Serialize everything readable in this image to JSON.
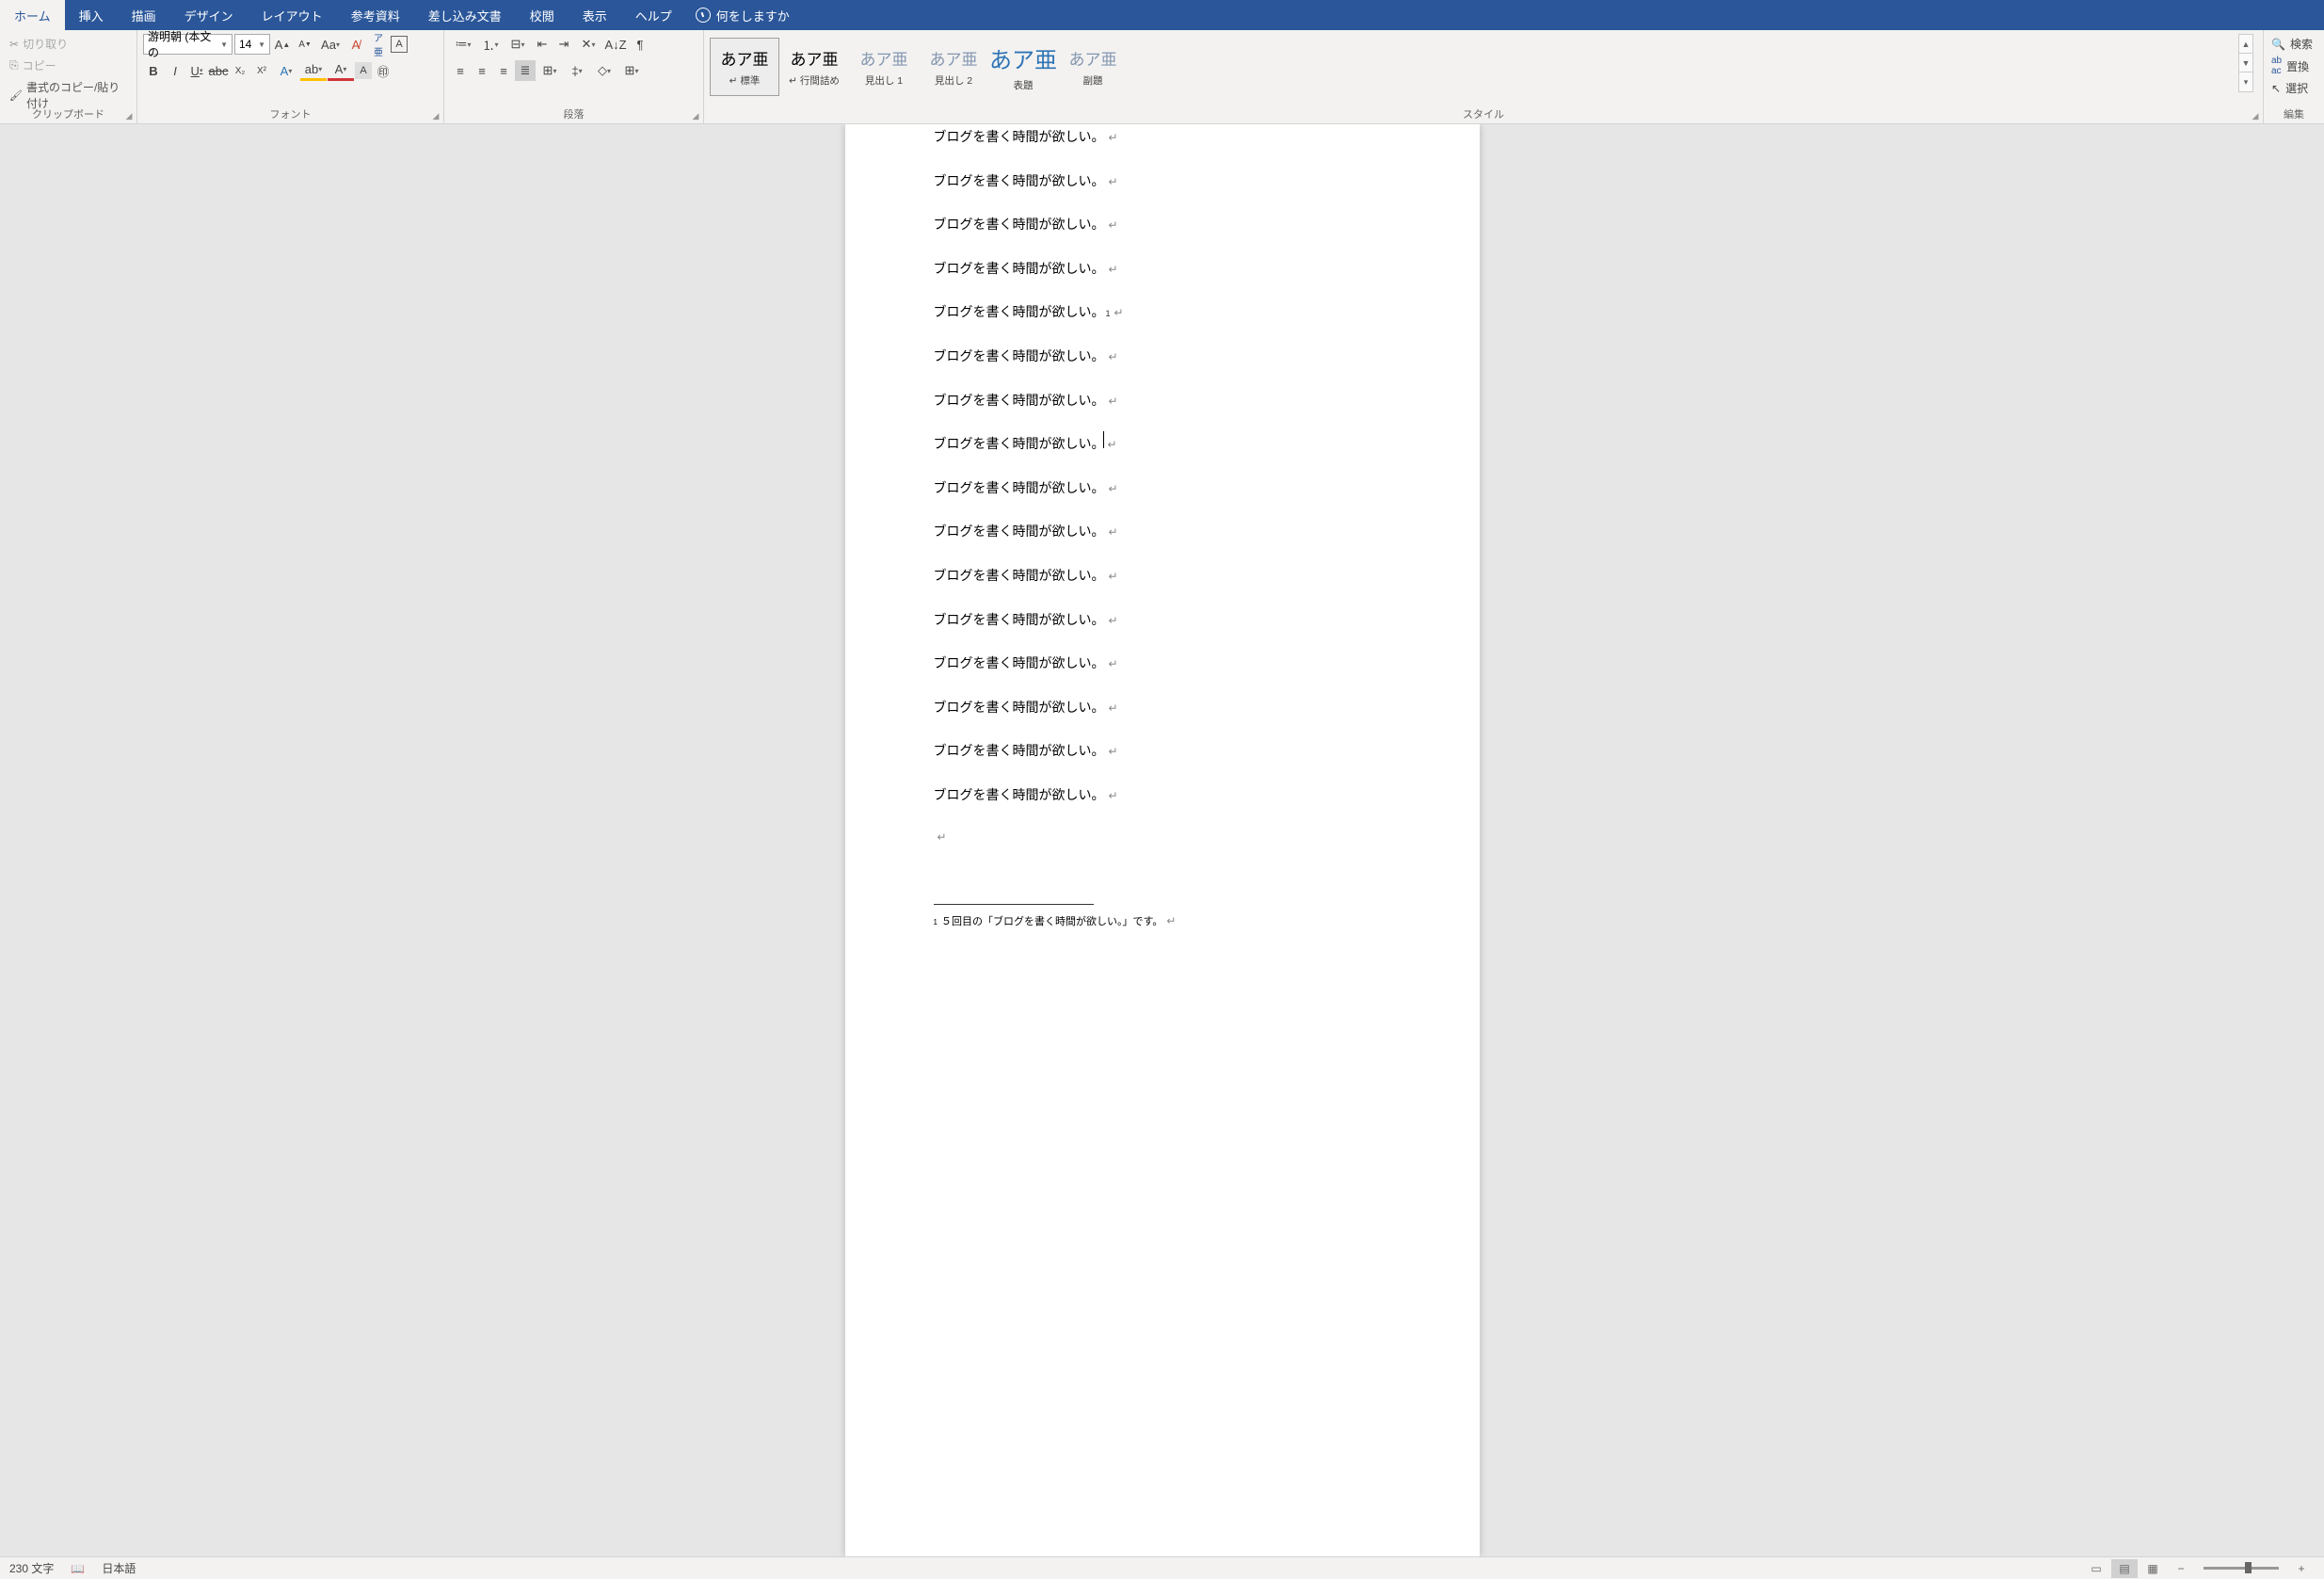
{
  "tabs": {
    "home": "ホーム",
    "insert": "挿入",
    "draw": "描画",
    "design": "デザイン",
    "layout": "レイアウト",
    "references": "参考資料",
    "mailings": "差し込み文書",
    "review": "校閲",
    "view": "表示",
    "help": "ヘルプ",
    "tellme": "何をしますか"
  },
  "clipboard": {
    "cut": "切り取り",
    "copy": "コピー",
    "paste": "書式のコピー/貼り付け",
    "label": "クリップボード"
  },
  "font": {
    "name": "游明朝 (本文の",
    "size": "14",
    "label": "フォント"
  },
  "paragraph": {
    "label": "段落"
  },
  "styles": {
    "label": "スタイル",
    "items": [
      {
        "preview": "あア亜",
        "name": "↵ 標準",
        "cls": "",
        "sel": true
      },
      {
        "preview": "あア亜",
        "name": "↵ 行間詰め",
        "cls": ""
      },
      {
        "preview": "あア亜",
        "name": "見出し 1",
        "cls": "light"
      },
      {
        "preview": "あア亜",
        "name": "見出し 2",
        "cls": "light"
      },
      {
        "preview": "あア亜",
        "name": "表題",
        "cls": "big"
      },
      {
        "preview": "あア亜",
        "name": "副題",
        "cls": "light"
      }
    ]
  },
  "editing": {
    "find": "検索",
    "replace": "置換",
    "select": "選択",
    "label": "編集"
  },
  "document": {
    "line": "ブログを書く時間が欲しい。",
    "footnote_ref": "1",
    "footnote_text": "５回目の「ブログを書く時間が欲しい。」です。",
    "lines_before_ref": 4,
    "lines_after_ref": 11,
    "cursor_line_index": 3
  },
  "status": {
    "words": "230 文字",
    "lang": "日本語"
  }
}
